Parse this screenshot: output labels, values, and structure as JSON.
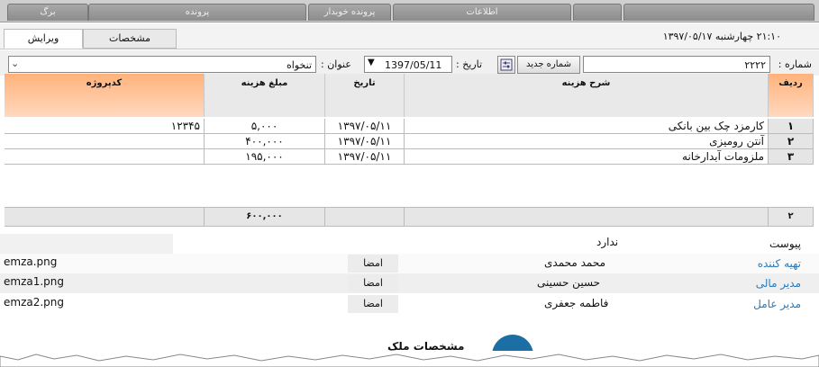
{
  "top_tabs": [
    "برگ",
    "پرونده",
    "پرونده خوبدار",
    "اطلاعات"
  ],
  "subtabs": {
    "edit": "ویرایش",
    "specs": "مشخصات"
  },
  "header_datetime": "۲۱:۱۰   چهارشنبه ۱۳۹۷/۰۵/۱۷",
  "form": {
    "number_label": "شماره :",
    "number_value": "۲۲۲۲",
    "new_number_button": "شماره جدید",
    "date_label": "تاریخ :",
    "date_value": "1397/05/11",
    "title_label": "عنوان :",
    "title_value": "تنخواه"
  },
  "table": {
    "headers": {
      "row": "ردیف",
      "description": "شرح هزینه",
      "date": "تاریخ",
      "amount": "مبلغ هزینه",
      "project_code": "کدپروژه"
    },
    "rows": [
      {
        "num": "۱",
        "description": "کارمزد چک بین بانکی",
        "date": "۱۳۹۷/۰۵/۱۱",
        "amount": "۵,۰۰۰",
        "project_code": "۱۲۳۴۵"
      },
      {
        "num": "۲",
        "description": "آنتن رومیزی",
        "date": "۱۳۹۷/۰۵/۱۱",
        "amount": "۴۰۰,۰۰۰",
        "project_code": ""
      },
      {
        "num": "۳",
        "description": "ملزومات آبدارخانه",
        "date": "۱۳۹۷/۰۵/۱۱",
        "amount": "۱۹۵,۰۰۰",
        "project_code": ""
      }
    ],
    "footer": {
      "count": "۲",
      "total": "۶۰۰,۰۰۰"
    }
  },
  "info": {
    "attachment_label": "پیوست",
    "attachment_value": "ندارد",
    "preparer_label": "تهیه کننده",
    "preparer_name": "محمد محمدی",
    "preparer_file": "emza.png",
    "finance_label": "مدیر مالی",
    "finance_name": "حسین حسینی",
    "finance_file": "emza1.png",
    "ceo_label": "مدیر عامل",
    "ceo_name": "فاطمه جعفری",
    "ceo_file": "emza2.png",
    "sign_label": "امضا"
  },
  "bottom_tab_label": "مشخصات ملک",
  "colors": {
    "accent_orange": "#ffb27a",
    "link_blue": "#2a7ab8",
    "circle_blue": "#1c6fa5"
  }
}
